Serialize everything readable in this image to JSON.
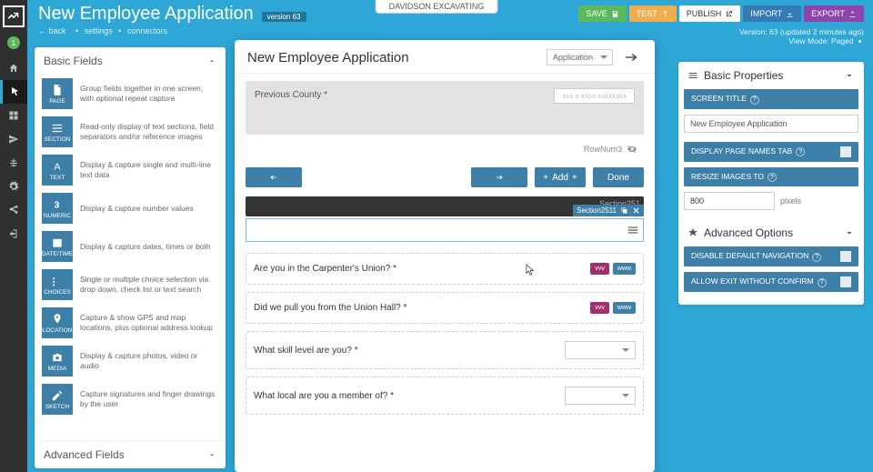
{
  "org_name": "DAVIDSON EXCAVATING",
  "header": {
    "title": "New Employee Application",
    "version_badge": "version 63",
    "crumbs": {
      "back": "back",
      "settings": "settings",
      "connectors": "connectors"
    },
    "buttons": {
      "save": "SAVE",
      "test": "TEST",
      "publish": "PUBLISH",
      "import": "IMPORT",
      "export": "EXPORT"
    },
    "meta_line1": "Version: 63 (updated 2 minutes ago)",
    "meta_line2": "View Mode: Paged"
  },
  "palette": {
    "basic_heading": "Basic Fields",
    "advanced_heading": "Advanced Fields",
    "fields": [
      {
        "code": "PAGE",
        "desc": "Group fields together in one screen, with optional repeat capture",
        "icon": "page"
      },
      {
        "code": "SECTION",
        "desc": "Read-only display of text sections, field separators and/or reference images",
        "icon": "section"
      },
      {
        "code": "TEXT",
        "desc": "Display & capture single and multi-line text data",
        "icon": "text"
      },
      {
        "code": "NUMERIC",
        "desc": "Display & capture number values",
        "icon": "numeric"
      },
      {
        "code": "DATE/TIME",
        "desc": "Display & capture dates, times or both",
        "icon": "date"
      },
      {
        "code": "CHOICES",
        "desc": "Single or multiple choice selection via drop down, check list or text search",
        "icon": "choices"
      },
      {
        "code": "LOCATION",
        "desc": "Capture & show GPS and map locations, plus optional address lookup",
        "icon": "location"
      },
      {
        "code": "MEDIA",
        "desc": "Display & capture photos, video or audio",
        "icon": "media"
      },
      {
        "code": "SKETCH",
        "desc": "Capture signatures and finger drawings by the user",
        "icon": "sketch"
      }
    ]
  },
  "canvas": {
    "title": "New Employee Application",
    "mode": "Application",
    "prev_label": "Previous County *",
    "prev_placeholder": "xxx x xxxx  xxxxxxxx",
    "rownum": "RowNum3",
    "add": "Add",
    "done": "Done",
    "section_tag": "Section251",
    "selection_badge": "Section2511",
    "questions": [
      {
        "text": "Are you in the Carpenter's Union? *",
        "type": "chips",
        "a": "vvv",
        "b": "www"
      },
      {
        "text": "Did we pull you from the Union Hall? *",
        "type": "chips",
        "a": "vvv",
        "b": "www"
      },
      {
        "text": "What skill level are you? *",
        "type": "dd"
      },
      {
        "text": "What local are you a member of? *",
        "type": "dd"
      }
    ]
  },
  "props": {
    "basic_heading": "Basic Properties",
    "adv_heading": "Advanced Options",
    "screen_title_label": "SCREEN TITLE",
    "screen_title_value": "New Employee Application",
    "display_tabs_label": "DISPLAY PAGE NAMES TAB",
    "resize_label": "RESIZE IMAGES TO",
    "resize_value": "800",
    "resize_unit": "pixels",
    "disable_nav_label": "DISABLE DEFAULT NAVIGATION",
    "allow_exit_label": "ALLOW EXIT WITHOUT CONFIRM"
  }
}
